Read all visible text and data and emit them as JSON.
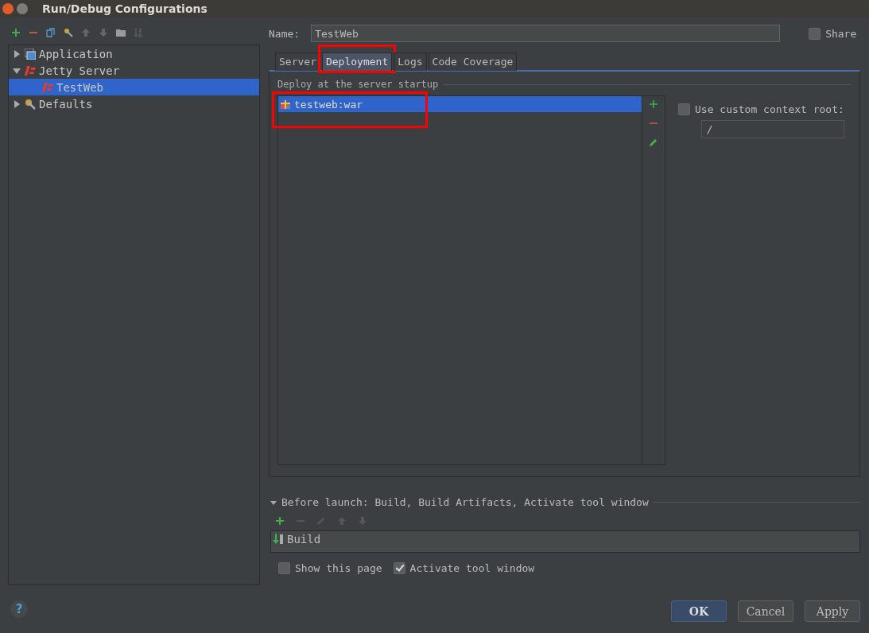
{
  "window": {
    "title": "Run/Debug Configurations"
  },
  "tree": [
    {
      "label": "Application",
      "kind": "application",
      "expanded": false,
      "selected": false
    },
    {
      "label": "Jetty Server",
      "kind": "jetty",
      "expanded": true,
      "selected": false,
      "children": [
        {
          "label": "TestWeb",
          "kind": "jetty",
          "selected": true
        }
      ]
    },
    {
      "label": "Defaults",
      "kind": "wrench",
      "expanded": false,
      "selected": false
    }
  ],
  "help": {
    "label": "?"
  },
  "name_field": {
    "label": "Name:",
    "value": "TestWeb"
  },
  "share": {
    "label": "Share",
    "checked": false
  },
  "tabs": [
    {
      "label": "Server",
      "selected": false,
      "highlighted": false
    },
    {
      "label": "Deployment",
      "selected": true,
      "highlighted": true
    },
    {
      "label": "Logs",
      "selected": false,
      "highlighted": false
    },
    {
      "label": "Code Coverage",
      "selected": false,
      "highlighted": false
    }
  ],
  "deployment": {
    "title": "Deploy at the server startup",
    "items": [
      {
        "label": "testweb:war",
        "selected": true,
        "highlighted": true
      }
    ],
    "context_root": {
      "label": "Use custom context root:",
      "checked": false,
      "value": "/"
    }
  },
  "before_launch": {
    "label": "Before launch: Build, Build Artifacts, Activate tool window",
    "expanded": true,
    "tasks": [
      {
        "label": "Build"
      }
    ]
  },
  "options": [
    {
      "label": "Show this page",
      "checked": false
    },
    {
      "label": "Activate tool window",
      "checked": true
    }
  ],
  "buttons": [
    {
      "label": "OK",
      "default": true
    },
    {
      "label": "Cancel",
      "default": false
    },
    {
      "label": "Apply",
      "default": false
    }
  ]
}
